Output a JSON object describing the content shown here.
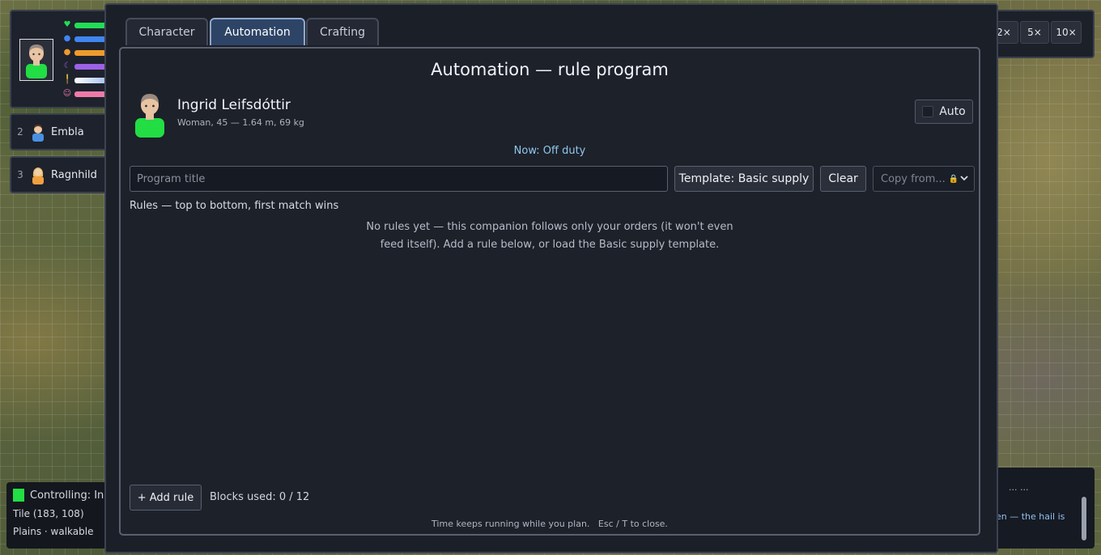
{
  "party": {
    "members": [
      {
        "num": "2",
        "name": "Embla"
      },
      {
        "num": "3",
        "name": "Ragnhild"
      }
    ]
  },
  "status": {
    "controlling": "Controlling: In",
    "tile": "Tile (183, 108)",
    "terrain": "Plains · walkable"
  },
  "speed": {
    "options": [
      "2×",
      "5×",
      "10×"
    ]
  },
  "log": {
    "line1": "... ...",
    "line2": "en — the hail is"
  },
  "tabs": [
    {
      "label": "Character"
    },
    {
      "label": "Automation"
    },
    {
      "label": "Crafting"
    }
  ],
  "automation": {
    "title": "Automation — rule program",
    "character_name": "Ingrid Leifsdóttir",
    "character_meta": "Woman, 45 — 1.64 m, 69 kg",
    "auto_label": "Auto",
    "now_status": "Now: Off duty",
    "program_title_placeholder": "Program title",
    "template_button": "Template: Basic supply",
    "clear_button": "Clear",
    "copy_from": "Copy from...",
    "rules_header": "Rules — top to bottom, first match wins",
    "empty_line1": "No rules yet — this companion follows only your orders (it won't even",
    "empty_line2": "feed itself). Add a rule below, or load the Basic supply template.",
    "add_rule": "+ Add rule",
    "blocks_used": "Blocks used: 0 / 12",
    "footer_hint": "Time keeps running while you plan.   Esc / T to close."
  },
  "colors": {
    "health": "#22dd55",
    "water": "#3f86f0",
    "food": "#ee9b2c",
    "sleep": "#9b62e6",
    "temperature": "#9ab8ee",
    "mood": "#ee7aa8",
    "active_tab": "#2e4466",
    "status_accent": "#8fc8ec"
  },
  "icons": [
    "heart-icon",
    "water-drop-icon",
    "food-icon",
    "moon-icon",
    "thermometer-icon",
    "mood-icon",
    "lock-icon",
    "chevron-down-icon"
  ]
}
